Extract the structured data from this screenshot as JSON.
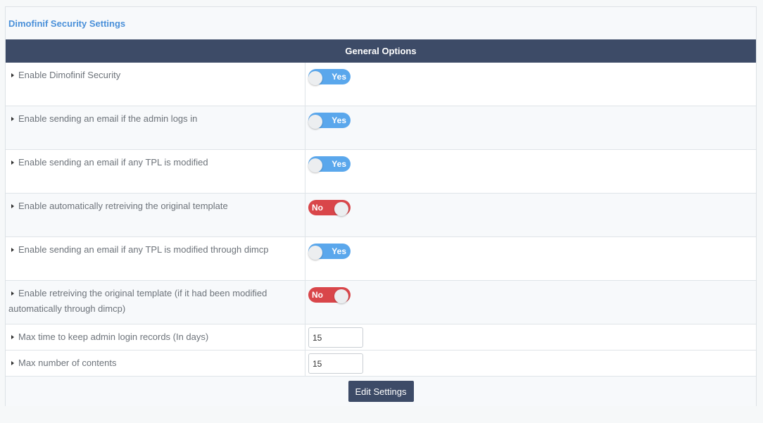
{
  "panel": {
    "title": "Dimofinif Security Settings"
  },
  "section": {
    "title": "General Options"
  },
  "options": [
    {
      "label": "Enable Dimofinif Security",
      "state": "Yes"
    },
    {
      "label": "Enable sending an email if the admin logs in",
      "state": "Yes"
    },
    {
      "label": "Enable sending an email if any TPL is modified",
      "state": "Yes"
    },
    {
      "label": "Enable automatically retreiving the original template",
      "state": "No"
    },
    {
      "label": "Enable sending an email if any TPL is modified through dimcp",
      "state": "Yes"
    },
    {
      "label": "Enable retreiving the original template (if it had been modified automatically through dimcp)",
      "state": "No"
    }
  ],
  "inputs": [
    {
      "label": "Max time to keep admin login records (In days)",
      "value": "15"
    },
    {
      "label": "Max number of contents",
      "value": "15"
    }
  ],
  "footer": {
    "button_label": "Edit Settings"
  },
  "colors": {
    "header_bg": "#3d4b67",
    "toggle_on": "#5aa7ec",
    "toggle_off": "#d9464a",
    "title": "#4a90d9"
  }
}
